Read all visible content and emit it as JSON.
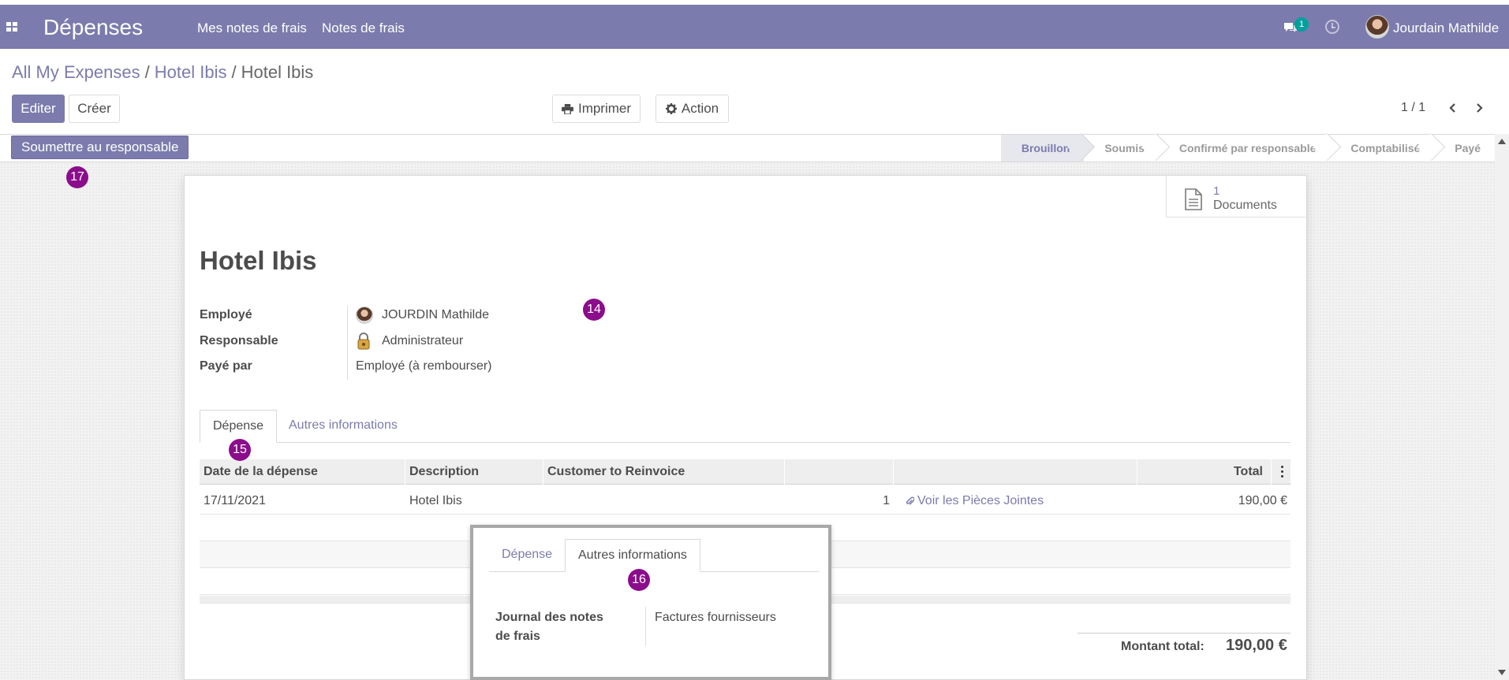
{
  "topbar": {
    "app_name": "Dépenses",
    "menu": [
      "Mes notes de frais",
      "Notes de frais"
    ],
    "chat_count": "1",
    "user_name": "Jourdain Mathilde"
  },
  "breadcrumb": {
    "items": [
      "All My Expenses",
      "Hotel Ibis"
    ],
    "current": "Hotel Ibis",
    "separator": "/"
  },
  "toolbar": {
    "edit_label": "Editer",
    "create_label": "Créer",
    "print_label": "Imprimer",
    "action_label": "Action",
    "pager": "1 / 1"
  },
  "statusbar": {
    "submit_label": "Soumettre au responsable",
    "stages": [
      "Brouillon",
      "Soumis",
      "Confirmé par responsable",
      "Comptabilisé",
      "Payé"
    ],
    "current_stage": "Brouillon"
  },
  "smart_button": {
    "count": "1",
    "label": "Documents"
  },
  "form": {
    "title": "Hotel Ibis",
    "fields": [
      {
        "label": "Employé",
        "value": "JOURDIN Mathilde"
      },
      {
        "label": "Responsable",
        "value": "Administrateur"
      },
      {
        "label": "Payé par",
        "value": "Employé (à rembourser)"
      }
    ]
  },
  "tabs": [
    "Dépense",
    "Autres informations"
  ],
  "table": {
    "headers": [
      "Date de la dépense",
      "Description",
      "Customer to Reinvoice",
      "",
      "",
      "Total"
    ],
    "rows": [
      {
        "date": "17/11/2021",
        "description": "Hotel Ibis",
        "customer": "",
        "qty": "1",
        "attachments": "Voir les Pièces Jointes",
        "total": "190,00 €"
      }
    ]
  },
  "totals": {
    "label": "Montant total:",
    "value": "190,00 €"
  },
  "popup": {
    "tabs": [
      "Dépense",
      "Autres informations"
    ],
    "field_label": "Journal des notes de frais",
    "field_value": "Factures fournisseurs"
  },
  "callouts": [
    "14",
    "15",
    "16",
    "17"
  ],
  "colors": {
    "brand": "#7c7bad",
    "callout": "#8b0d8b",
    "badge": "#00a09d"
  }
}
